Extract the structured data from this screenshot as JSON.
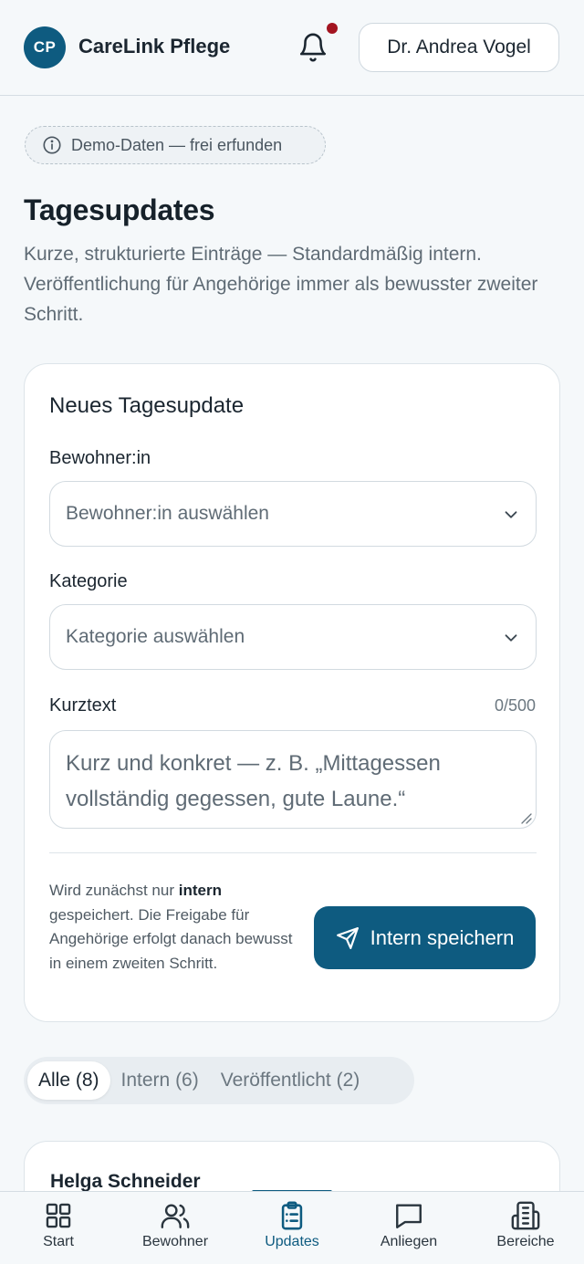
{
  "header": {
    "brand_initials": "CP",
    "brand_name": "CareLink Pflege",
    "user_name": "Dr. Andrea Vogel",
    "notification_dot_color": "#a31420"
  },
  "demo_notice": "Demo-Daten — frei erfunden",
  "page": {
    "title": "Tagesupdates",
    "subtitle": "Kurze, strukturierte Einträge — Standardmäßig intern. Veröffentlichung für Angehörige immer als bewusster zweiter Schritt."
  },
  "form": {
    "title": "Neues Tagesupdate",
    "resident_label": "Bewohner:in",
    "resident_placeholder": "Bewohner:in auswählen",
    "category_label": "Kategorie",
    "category_placeholder": "Kategorie auswählen",
    "text_label": "Kurztext",
    "text_counter": "0/500",
    "text_placeholder": "Kurz und konkret — z. B. „Mittagessen vollständig gegessen, gute Laune.“",
    "hint_prefix": "Wird zunächst nur ",
    "hint_bold": "intern",
    "hint_suffix": " gespeichert. Die Freigabe für Angehörige erfolgt danach bewusst in einem zweiten Schritt.",
    "save_label": "Intern speichern"
  },
  "filters": [
    {
      "label": "Alle (8)",
      "active": true
    },
    {
      "label": "Intern (6)",
      "active": false
    },
    {
      "label": "Veröffentlicht (2)",
      "active": false
    }
  ],
  "entries": [
    {
      "name": "Helga Schneider"
    }
  ],
  "nav": [
    {
      "label": "Start",
      "icon": "grid-icon"
    },
    {
      "label": "Bewohner",
      "icon": "users-icon"
    },
    {
      "label": "Updates",
      "icon": "clipboard-list-icon",
      "active": true
    },
    {
      "label": "Anliegen",
      "icon": "message-icon"
    },
    {
      "label": "Bereiche",
      "icon": "building-icon"
    }
  ],
  "colors": {
    "primary": "#0e5b80",
    "background": "#f5f8fa"
  }
}
